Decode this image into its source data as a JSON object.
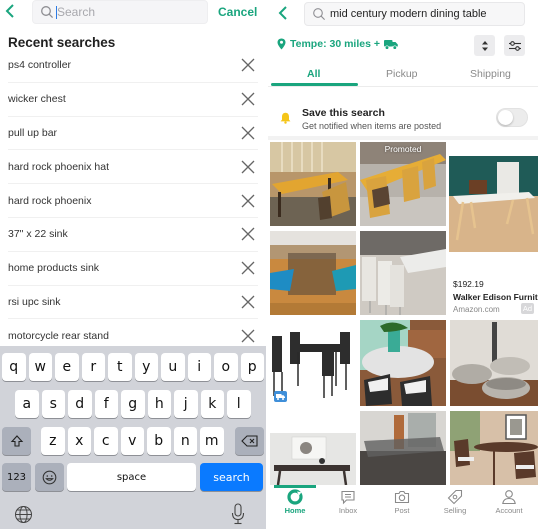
{
  "left_pane": {
    "search": {
      "placeholder": "Search",
      "value": ""
    },
    "cancel_label": "Cancel",
    "recent_title": "Recent searches",
    "recent_searches": [
      "ps4 controller",
      "wicker chest",
      "pull up bar",
      "hard rock phoenix hat",
      "hard rock phoenix",
      "37\" x 22 sink",
      "home products sink",
      "rsi upc sink",
      "motorcycle rear stand"
    ],
    "keyboard": {
      "row1": [
        "q",
        "w",
        "e",
        "r",
        "t",
        "y",
        "u",
        "i",
        "o",
        "p"
      ],
      "row2": [
        "a",
        "s",
        "d",
        "f",
        "g",
        "h",
        "j",
        "k",
        "l"
      ],
      "row3": [
        "z",
        "x",
        "c",
        "v",
        "b",
        "n",
        "m"
      ],
      "numbers_label": "123",
      "space_label": "space",
      "search_label": "search",
      "icons": {
        "shift": "shift-icon",
        "backspace": "backspace-icon",
        "emoji": "emoji-icon",
        "globe": "globe-icon",
        "mic": "microphone-icon"
      }
    }
  },
  "right_pane": {
    "search_query": "mid century modern dining table",
    "location_label": "Tempe: 30 miles +",
    "tabs": [
      {
        "label": "All",
        "active": true
      },
      {
        "label": "Pickup",
        "active": false
      },
      {
        "label": "Shipping",
        "active": false
      }
    ],
    "save_search": {
      "title": "Save this search",
      "subtitle": "Get notified when items are posted",
      "toggle_on": false
    },
    "listings": [
      {
        "desc": "wood dining table with chairs",
        "promoted": false
      },
      {
        "desc": "long wood table with chairs",
        "promoted": true,
        "badge": "Promoted"
      },
      {
        "desc": "glass table with teal chairs",
        "promoted": false
      },
      {
        "desc": "white retro table with chairs",
        "promoted": false
      },
      {
        "desc": "black dining set",
        "promoted": false,
        "shipping_badge": true
      },
      {
        "desc": "round table with plant",
        "promoted": false
      },
      {
        "desc": "metal bowls stand",
        "promoted": false
      },
      {
        "desc": "console table",
        "promoted": false
      },
      {
        "desc": "glass table in room",
        "promoted": false
      },
      {
        "desc": "walnut dining set",
        "promoted": false
      }
    ],
    "ad": {
      "price": "$192.19",
      "title": "Walker Edison Furnit...",
      "source": "Amazon.com",
      "badge": "Ad"
    },
    "bottom_nav": [
      {
        "label": "Home",
        "icon": "home-icon",
        "active": true
      },
      {
        "label": "Inbox",
        "icon": "inbox-icon",
        "active": false
      },
      {
        "label": "Post",
        "icon": "camera-icon",
        "active": false
      },
      {
        "label": "Selling",
        "icon": "tag-icon",
        "active": false
      },
      {
        "label": "Account",
        "icon": "account-icon",
        "active": false
      }
    ]
  },
  "colors": {
    "brand_green": "#1aa57e",
    "ios_blue": "#0a7aff",
    "bell_yellow": "#f5c518",
    "keyboard_bg": "#d1d3d9"
  }
}
